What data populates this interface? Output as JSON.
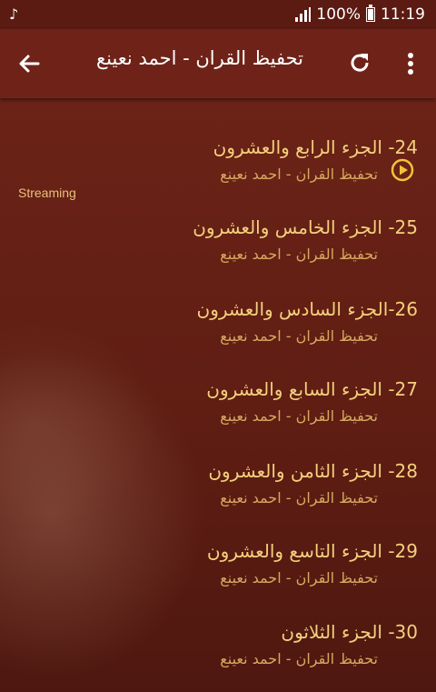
{
  "status_bar": {
    "battery": "100%",
    "time": "11:19",
    "left_icon": "music-note-icon"
  },
  "app_bar": {
    "title": "تحفيظ القران - احمد نعينع",
    "back_icon": "arrow-back-icon",
    "refresh_icon": "refresh-icon",
    "menu_icon": "more-vert-icon"
  },
  "streaming_label": "Streaming",
  "items": [
    {
      "title": "24- الجزء الرابع والعشرون",
      "subtitle": "تحفيظ القران - احمد نعينع",
      "playing": true
    },
    {
      "title": "25- الجزء الخامس والعشرون",
      "subtitle": "تحفيظ القران - احمد نعينع"
    },
    {
      "title": "26-الجزء السادس والعشرون",
      "subtitle": "تحفيظ القران - احمد نعينع"
    },
    {
      "title": "27- الجزء السابع والعشرون",
      "subtitle": "تحفيظ القران - احمد نعينع"
    },
    {
      "title": "28- الجزء الثامن والعشرون",
      "subtitle": "تحفيظ القران - احمد نعينع"
    },
    {
      "title": "29- الجزء التاسع والعشرون",
      "subtitle": "تحفيظ القران - احمد نعينع"
    },
    {
      "title": "30- الجزء الثلاثون",
      "subtitle": "تحفيظ القران - احمد نعينع"
    }
  ],
  "colors": {
    "title_text": "#f4d07c",
    "subtitle_text": "#d6a960",
    "app_bar": "#6f2318",
    "play_icon": "#f2c23a"
  }
}
